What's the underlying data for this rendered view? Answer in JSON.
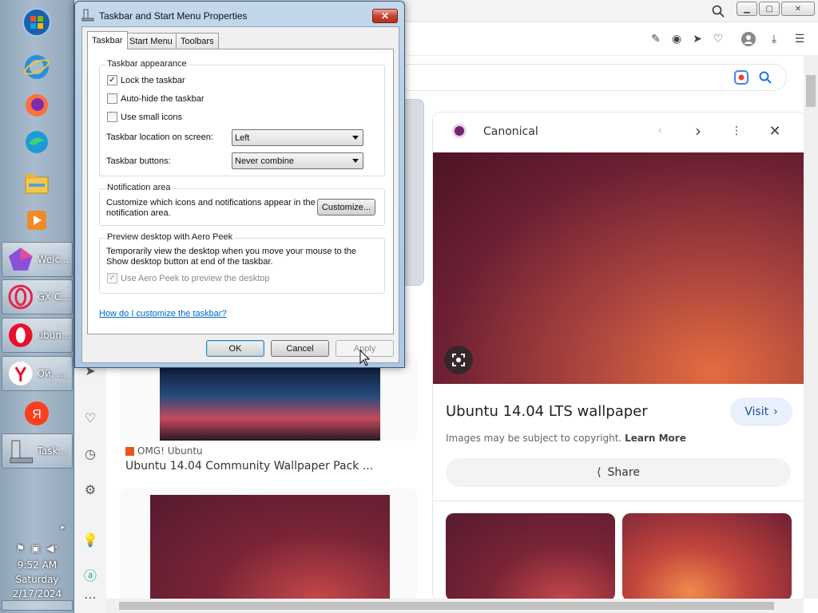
{
  "taskbar": {
    "windows": [
      {
        "label": "Welc...",
        "icon": "app-diamond-icon"
      },
      {
        "label": "GX C...",
        "icon": "opera-gx-icon"
      },
      {
        "label": "ubun...",
        "icon": "opera-icon"
      },
      {
        "label": "Ой, ...",
        "icon": "yandex-browser-icon"
      },
      {
        "label": "Task...",
        "icon": "taskbar-properties-icon"
      }
    ],
    "clock": {
      "time": "9:52 AM",
      "day": "Saturday",
      "date": "2/17/2024"
    }
  },
  "dialog": {
    "title": "Taskbar and Start Menu Properties",
    "close": "✕",
    "tabs": [
      "Taskbar",
      "Start Menu",
      "Toolbars"
    ],
    "appearance": {
      "title": "Taskbar appearance",
      "lock": "Lock the taskbar",
      "autohide": "Auto-hide the taskbar",
      "small_icons": "Use small icons",
      "location_label": "Taskbar location on screen:",
      "location_value": "Left",
      "buttons_label": "Taskbar buttons:",
      "buttons_value": "Never combine"
    },
    "notification": {
      "title": "Notification area",
      "text": "Customize which icons and notifications appear in the notification area.",
      "customize": "Customize..."
    },
    "peek": {
      "title": "Preview desktop with Aero Peek",
      "text": "Temporarily view the desktop when you move your mouse to the Show desktop button at end of the taskbar.",
      "checkbox": "Use Aero Peek to preview the desktop"
    },
    "help_link": "How do I customize the taskbar?",
    "ok": "OK",
    "cancel": "Cancel",
    "apply": "Apply",
    "check": "✓"
  },
  "panel": {
    "source": "Canonical",
    "title": "Ubuntu 14.04 LTS wallpaper",
    "visit": "Visit",
    "copyright": "Images may be subject to copyright.",
    "learn_more": "Learn More",
    "share": "Share"
  },
  "results": {
    "source": "OMG! Ubuntu",
    "title": "Ubuntu 14.04 Community Wallpaper Pack ..."
  },
  "colors": {
    "accent_blue": "#1a73e8",
    "canonical_dot": "#77216f",
    "dialog_frame": "#b5cde5"
  }
}
